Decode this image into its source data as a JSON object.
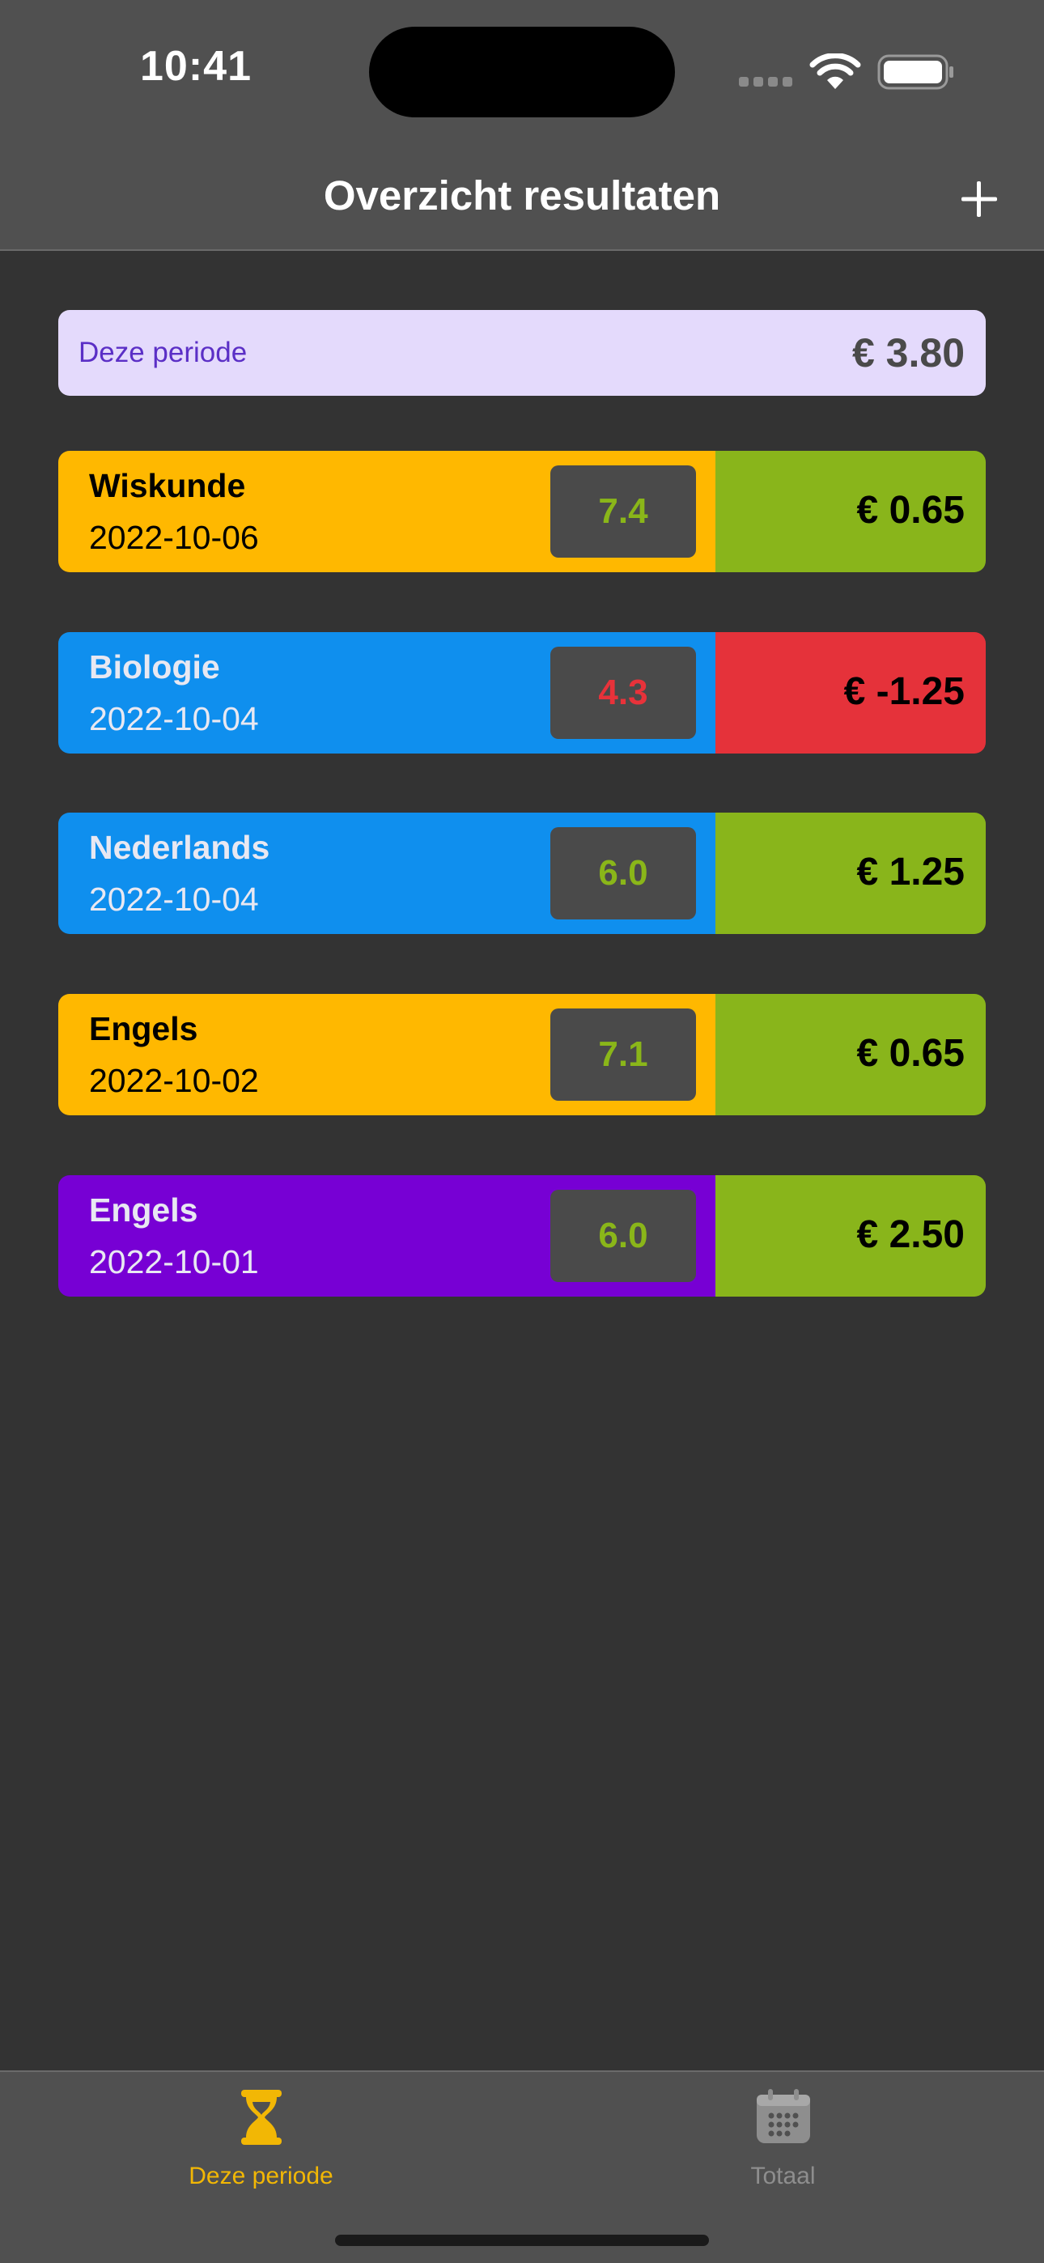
{
  "status_bar": {
    "time": "10:41"
  },
  "nav": {
    "title": "Overzicht resultaten",
    "add_icon": "plus-icon"
  },
  "summary": {
    "label": "Deze periode",
    "value": "€ 3.80"
  },
  "results": [
    {
      "subject": "Wiskunde",
      "date": "2022-10-06",
      "grade": "7.4",
      "amount": "€ 0.65",
      "subject_color": "#ffb800",
      "text_color": "#000000",
      "grade_color": "#8ab619",
      "amount_bg": "#89b51b"
    },
    {
      "subject": "Biologie",
      "date": "2022-10-04",
      "grade": "4.3",
      "amount": "€ -1.25",
      "subject_color": "#0f8fee",
      "text_color": "#e8e8f2",
      "grade_color": "#e8323a",
      "amount_bg": "#e5323a"
    },
    {
      "subject": "Nederlands",
      "date": "2022-10-04",
      "grade": "6.0",
      "amount": "€ 1.25",
      "subject_color": "#0f8fee",
      "text_color": "#e8e8f2",
      "grade_color": "#8ab619",
      "amount_bg": "#89b51b"
    },
    {
      "subject": "Engels",
      "date": "2022-10-02",
      "grade": "7.1",
      "amount": "€ 0.65",
      "subject_color": "#ffb800",
      "text_color": "#000000",
      "grade_color": "#8ab619",
      "amount_bg": "#89b51b"
    },
    {
      "subject": "Engels",
      "date": "2022-10-01",
      "grade": "6.0",
      "amount": "€ 2.50",
      "subject_color": "#7700d4",
      "text_color": "#e8e8f2",
      "grade_color": "#8ab619",
      "amount_bg": "#89b51b"
    }
  ],
  "tabs": [
    {
      "label": "Deze periode",
      "icon": "hourglass-icon",
      "active": true,
      "color": "#f2b705"
    },
    {
      "label": "Totaal",
      "icon": "calendar-icon",
      "active": false,
      "color": "#8e8e8e"
    }
  ],
  "colors": {
    "background": "#333333",
    "bars": "#505050",
    "accent": "#f2b705"
  }
}
